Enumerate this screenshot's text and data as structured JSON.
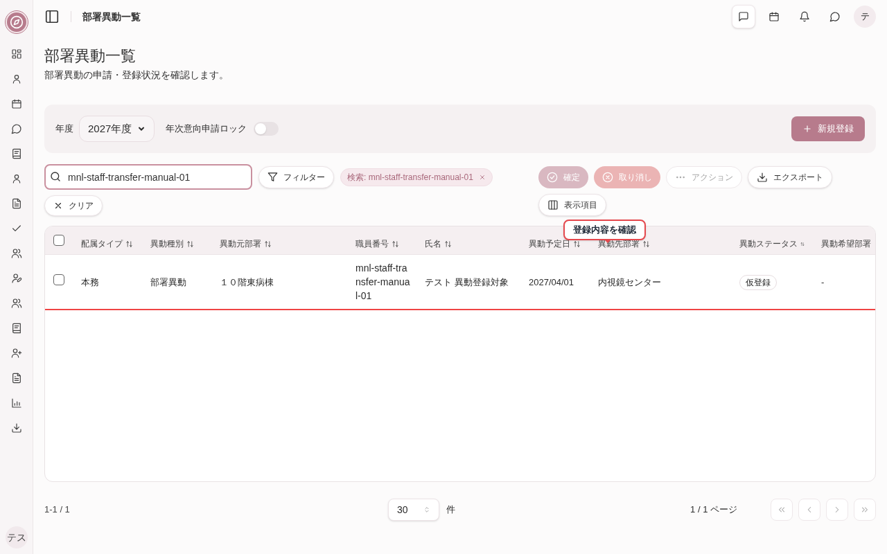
{
  "sidebar": {
    "items": [
      {
        "kind": "grid"
      },
      {
        "kind": "user"
      },
      {
        "kind": "calendar"
      },
      {
        "kind": "chat"
      },
      {
        "kind": "book"
      },
      {
        "kind": "user"
      },
      {
        "kind": "file"
      },
      {
        "kind": "check"
      },
      {
        "kind": "users"
      },
      {
        "kind": "user-pen"
      },
      {
        "kind": "users"
      },
      {
        "kind": "book"
      },
      {
        "kind": "user-plus"
      },
      {
        "kind": "file"
      },
      {
        "kind": "chart"
      },
      {
        "kind": "download"
      }
    ],
    "user_avatar": "テス"
  },
  "header": {
    "title": "部署異動一覧",
    "actions": [
      {
        "kind": "message",
        "selected": true
      },
      {
        "kind": "calendar",
        "selected": false
      },
      {
        "kind": "bell",
        "selected": false
      },
      {
        "kind": "chat",
        "selected": false
      }
    ],
    "avatar": "テ"
  },
  "page": {
    "title": "部署異動一覧",
    "subtitle": "部署異動の申請・登録状況を確認します。"
  },
  "filters": {
    "year_label": "年度",
    "year_value": "2027年度",
    "lock": {
      "label": "年次意向申請ロック",
      "on": false
    },
    "new_button": "新規登録"
  },
  "toolbar": {
    "search": {
      "value": "mnl-staff-transfer-manual-01"
    },
    "filter_button": "フィルター",
    "chip": "検索: mnl-staff-transfer-manual-01",
    "clear_button": "クリア",
    "actions": [
      {
        "kind": "confirm",
        "label": "確定",
        "disabled": true
      },
      {
        "kind": "cancel",
        "label": "取り消し",
        "disabled": true
      },
      {
        "kind": "more",
        "label": "アクション",
        "disabled": true
      },
      {
        "kind": "export",
        "label": "エクスポート",
        "disabled": false
      },
      {
        "kind": "columns",
        "label": "表示項目",
        "disabled": false
      }
    ]
  },
  "tooltip": "登録内容を確認",
  "table": {
    "all_checked": false,
    "columns": [
      "配属タイプ",
      "異動種別",
      "異動元部署",
      "職員番号",
      "氏名",
      "異動予定日",
      "異動先部署",
      "異動ステータス",
      "異動希望部署"
    ],
    "rows": [
      {
        "checked": false,
        "highlighted": true,
        "cells": [
          "本務",
          "部署異動",
          "１０階東病棟",
          "mnl-staff-transfer-manual-01",
          "テスト 異動登録対象",
          "2027/04/01",
          "内視鏡センター",
          "仮登録",
          "-"
        ]
      }
    ]
  },
  "pagination": {
    "range": "1-1 / 1",
    "page_size": "30",
    "unit": "件",
    "pages": "1 / 1 ページ"
  }
}
